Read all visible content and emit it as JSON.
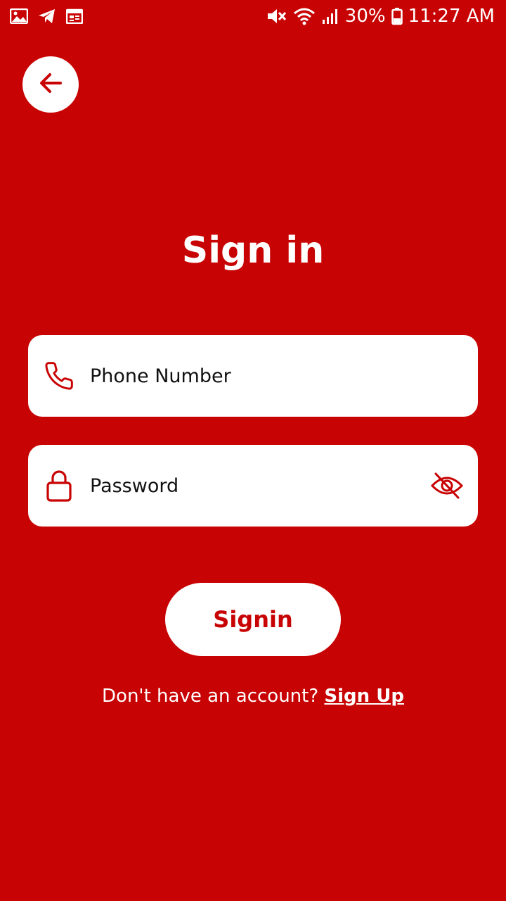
{
  "theme": {
    "background": "#c80303",
    "surface": "#ffffff",
    "accent": "#c80303",
    "text_on_background": "#ffffff",
    "text_on_surface": "#111111"
  },
  "status_bar": {
    "left_icons": [
      "gallery-icon",
      "telegram-icon",
      "calendar-icon"
    ],
    "right_icons": [
      "mute-icon",
      "wifi-icon",
      "signal-icon",
      "battery-icon"
    ],
    "battery": "30%",
    "time": "11:27 AM"
  },
  "header": {
    "back_icon": "arrow-left-icon"
  },
  "page": {
    "title": "Sign in"
  },
  "form": {
    "phone": {
      "icon": "phone-icon",
      "placeholder": "Phone Number",
      "value": ""
    },
    "password": {
      "icon": "lock-icon",
      "placeholder": "Password",
      "value": "",
      "toggle_icon": "eye-off-icon"
    },
    "submit_label": "Signin"
  },
  "footer": {
    "prompt": "Don't have an account?",
    "link_label": "Sign Up"
  }
}
